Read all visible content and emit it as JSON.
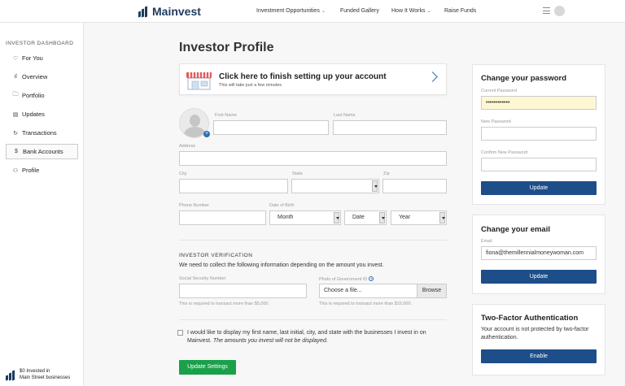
{
  "header": {
    "brand": "Mainvest",
    "nav": [
      {
        "label": "Investment Opportunities",
        "has_dropdown": true
      },
      {
        "label": "Funded Gallery",
        "has_dropdown": false
      },
      {
        "label": "How It Works",
        "has_dropdown": true
      },
      {
        "label": "Raise Funds",
        "has_dropdown": false
      }
    ],
    "chevron": "⌄",
    "menu_icon": "hamburger-icon",
    "avatar_icon": "avatar"
  },
  "sidebar": {
    "title": "INVESTOR DASHBOARD",
    "items": [
      {
        "label": "For You",
        "icon": "heart-icon",
        "glyph": "♡"
      },
      {
        "label": "Overview",
        "icon": "bar-chart-icon",
        "glyph": "ıl"
      },
      {
        "label": "Portfolio",
        "icon": "folder-icon",
        "glyph": "🗀"
      },
      {
        "label": "Updates",
        "icon": "calendar-icon",
        "glyph": "▤"
      },
      {
        "label": "Transactions",
        "icon": "refresh-icon",
        "glyph": "↻"
      },
      {
        "label": "Bank Accounts",
        "icon": "dollar-icon",
        "glyph": "$",
        "active": true
      },
      {
        "label": "Profile",
        "icon": "user-icon",
        "glyph": "⚇"
      }
    ],
    "footer_line1": "$0 Invested in",
    "footer_line2": "Main Street businesses"
  },
  "main": {
    "title": "Investor Profile",
    "finish_card": {
      "title": "Click here to finish setting up your account",
      "subtitle": "This will take just a few minutes"
    },
    "form": {
      "first_name_label": "First Name",
      "last_name_label": "Last Name",
      "address_label": "Address",
      "city_label": "City",
      "state_label": "State",
      "zip_label": "Zip",
      "phone_label": "Phone Number",
      "dob_label": "Date of Birth",
      "month": "Month",
      "date": "Date",
      "year": "Year"
    },
    "verification": {
      "title": "INVESTOR VERIFICATION",
      "description": "We need to collect the following information depending on the amount you invest.",
      "ssn_label": "Social Security Number",
      "ssn_hint": "This is required to transact more than $5,000.",
      "gov_id_label": "Photo of Government ID",
      "file_placeholder": "Choose a file...",
      "browse": "Browse",
      "gov_id_hint": "This is required to transact more than $15,000."
    },
    "consent_text": "I would like to display my first name, last initial, city, and state with the businesses I invest in on Mainvest.",
    "consent_italic": "The amounts you invest will not be displayed.",
    "update_button": "Update Settings"
  },
  "password_panel": {
    "title": "Change your password",
    "current_label": "Current Password",
    "current_value": "••••••••••••",
    "new_label": "New Password",
    "confirm_label": "Confirm New Password",
    "button": "Update"
  },
  "email_panel": {
    "title": "Change your email",
    "email_label": "Email",
    "email_value": "fiona@themillennialmoneywoman.com",
    "button": "Update"
  },
  "tfa_panel": {
    "title": "Two-Factor Authentication",
    "text": "Your account is not protected by two-factor authentication.",
    "button": "Enable"
  },
  "colors": {
    "accent_blue": "#1d4e89",
    "success_green": "#1aa04b",
    "brand_navy": "#1f3a5f",
    "autofill_yellow": "#fdf8d3"
  }
}
